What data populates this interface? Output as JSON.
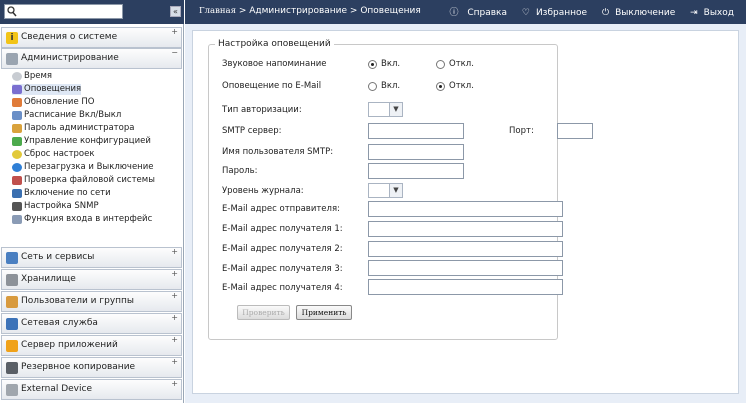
{
  "search": {
    "placeholder": ""
  },
  "header": {
    "breadcrumb_home": "Главная",
    "breadcrumb_rest": " > Администрирование > Оповещения",
    "help": "Справка",
    "favorites": "Избранное",
    "shutdown": "Выключение",
    "logout": "Выход"
  },
  "sidebar": {
    "system_info": "Сведения о системе",
    "admin": "Администрирование",
    "admin_items": [
      "Время",
      "Оповещения",
      "Обновление ПО",
      "Расписание Вкл/Выкл",
      "Пароль администратора",
      "Управление конфигурацией",
      "Сброс настроек",
      "Перезагрузка и Выключение",
      "Проверка файловой системы",
      "Включение по сети",
      "Настройка SNMP",
      "Функция входа в интерфейс"
    ],
    "sections": [
      "Сеть и сервисы",
      "Хранилище",
      "Пользователи и группы",
      "Сетевая служба",
      "Сервер приложений",
      "Резервное копирование",
      "External Device"
    ]
  },
  "form": {
    "legend": "Настройка оповещений",
    "beep_label": "Звуковое напоминание",
    "email_label": "Оповещение по E-Mail",
    "on": "Вкл.",
    "off": "Откл.",
    "beep_value": "on",
    "email_value": "off",
    "auth_label": "Тип авторизации:",
    "smtp_label": "SMTP сервер:",
    "port_label": "Порт:",
    "smtp_user_label": "Имя пользователя SMTP:",
    "password_label": "Пароль:",
    "log_level_label": "Уровень журнала:",
    "sender_label": "E-Mail адрес отправителя:",
    "rcpt1_label": "E-Mail адрес получателя 1:",
    "rcpt2_label": "E-Mail адрес получателя 2:",
    "rcpt3_label": "E-Mail адрес получателя 3:",
    "rcpt4_label": "E-Mail адрес получателя 4:",
    "test_button": "Проверить",
    "apply_button": "Применить"
  },
  "colors": {
    "header_bg": "#2c3f60",
    "content_bg": "#e8eef7",
    "accent": "#dfe8f5"
  }
}
